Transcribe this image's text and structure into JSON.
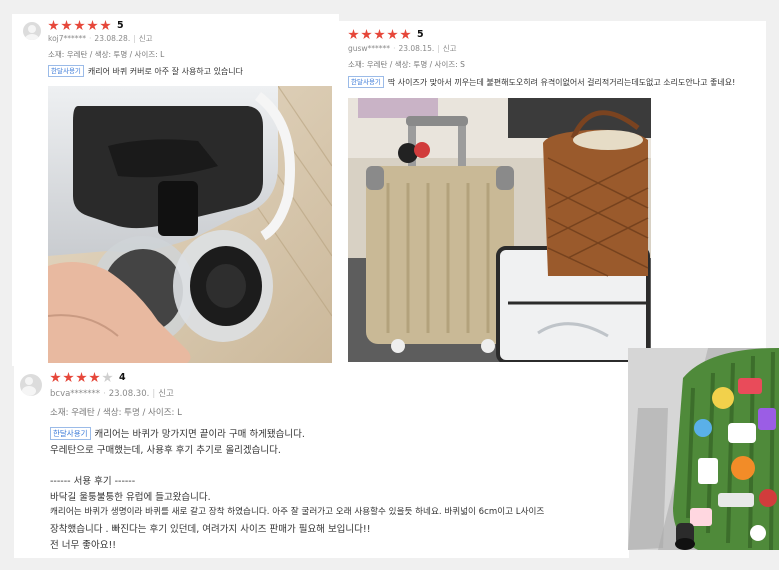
{
  "reviews": [
    {
      "rating": 5,
      "score_label": "5",
      "user": "koj7******",
      "date": "23.08.28.",
      "report": "신고",
      "options": "소재: 우레탄 / 색상: 투명 / 사이즈: L",
      "badge": "한달사용기",
      "lines": [
        "캐리어 바퀴 커버로 아주 잘 사용하고 있습니다"
      ],
      "photo_icon": "caster-wheel-cover-photo"
    },
    {
      "rating": 5,
      "score_label": "5",
      "user": "gusw******",
      "date": "23.08.15.",
      "report": "신고",
      "options": "소재: 우레탄 / 색상: 투명 / 사이즈: S",
      "badge": "한달사용기",
      "lines": [
        "딱 사이즈가 맞아서 끼우는데 불편해도오히려 유격이없어서 걸리적거리는데도없고 소리도안나고 좋네요!"
      ],
      "photo_icon": "suitcases-and-basket-photo"
    },
    {
      "rating": 4,
      "score_label": "4",
      "user": "bcva*******",
      "date": "23.08.30.",
      "report": "신고",
      "options": "소재: 우레탄 / 색상: 투명 / 사이즈: L",
      "badge": "한달사용기",
      "lines": [
        "캐리어는 바퀴가 망가지면 끝이라 구매 하게됐습니다.",
        "우레탄으로 구매했는데, 사용후 후기 추기로 올리겠습니다.",
        "",
        "------ 서용 후기 ------",
        "바닥길 울퉁불퉁한 유럽에 들고왔습니다.",
        "캐리어는 바퀴가 생명이라 바퀴를 새로 갈고 장착 하였습니다. 아주 잘 굴러가고 오래 사용할수 있을듯 하네요. 바퀴넓이 6cm이고 L사이즈",
        "장착했습니다 . 빠진다는 후기 있던데, 여려가지 사이즈 판매가 필요해 보입니다!!",
        "전 너무 좋아요!!"
      ],
      "photo_icon": "green-sticker-suitcase-photo"
    }
  ],
  "colors": {
    "star": "#e6473a",
    "badge_text": "#3b7ad8",
    "background": "#f0f0f0"
  }
}
